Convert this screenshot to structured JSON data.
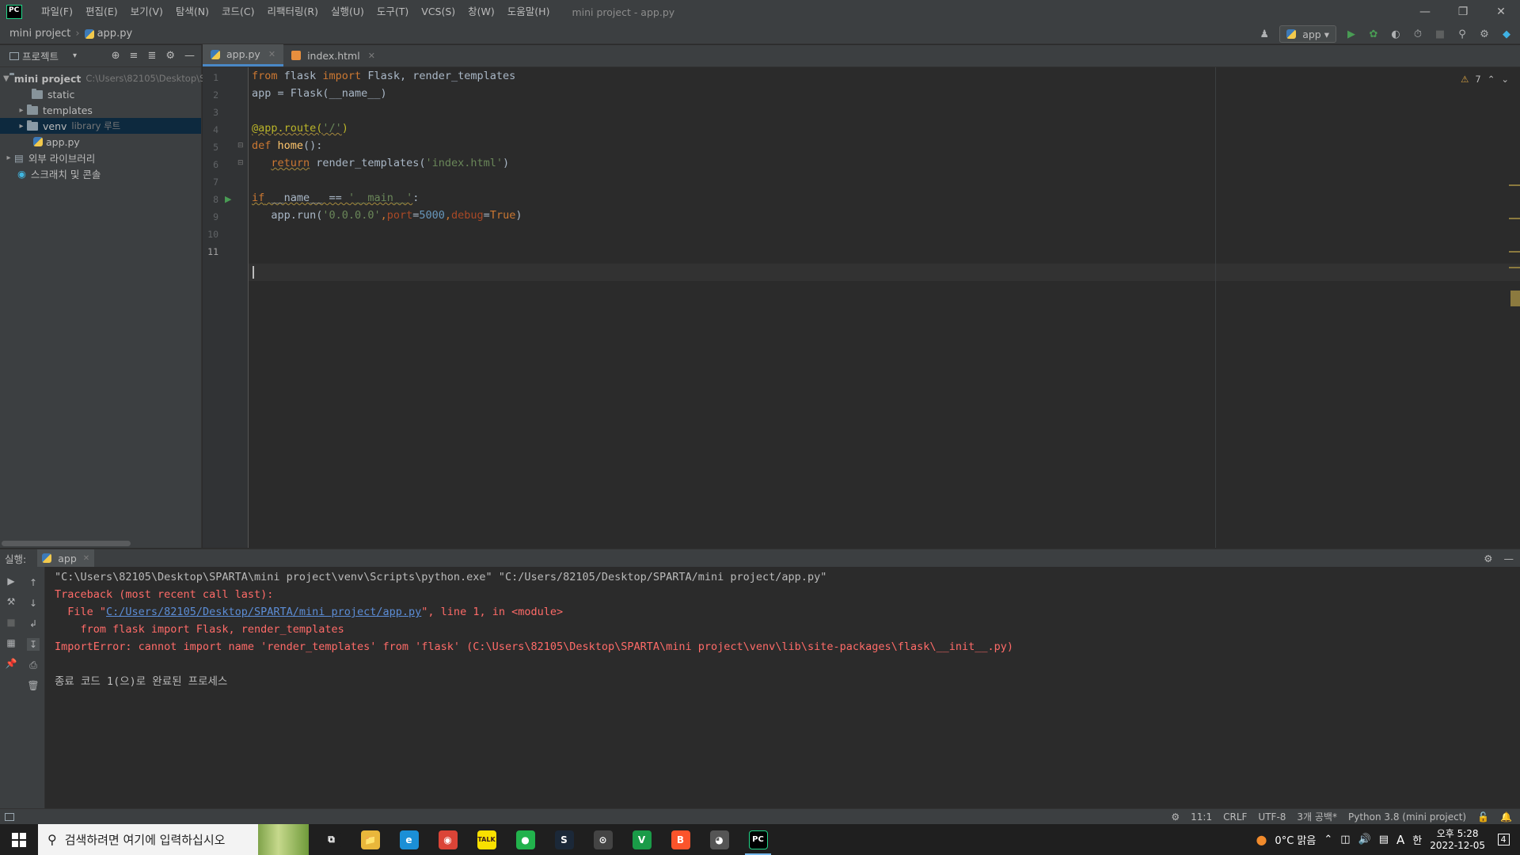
{
  "titlebar": {
    "menu": [
      "파일(F)",
      "편집(E)",
      "보기(V)",
      "탐색(N)",
      "코드(C)",
      "리팩터링(R)",
      "실행(U)",
      "도구(T)",
      "VCS(S)",
      "창(W)",
      "도움말(H)"
    ],
    "window_title": "mini project - app.py",
    "logo": "PC"
  },
  "navbar": {
    "project": "mini project",
    "file": "app.py",
    "run_config": "app"
  },
  "project_panel": {
    "title": "프로젝트",
    "tree": [
      {
        "label": "mini project",
        "hint": "C:\\Users\\82105\\Desktop\\SPARTA\\mini project"
      },
      {
        "label": "static"
      },
      {
        "label": "templates"
      },
      {
        "label": "venv",
        "hint": "library 루트"
      },
      {
        "label": "app.py"
      },
      {
        "label": "외부 라이브러리"
      },
      {
        "label": "스크래치 및 콘솔"
      }
    ]
  },
  "editor": {
    "tabs": [
      {
        "label": "app.py",
        "active": true
      },
      {
        "label": "index.html",
        "active": false
      }
    ],
    "line_numbers": [
      "1",
      "2",
      "3",
      "4",
      "5",
      "6",
      "7",
      "8",
      "9",
      "10",
      "11"
    ],
    "warnings": "7",
    "code": {
      "l1": {
        "kw1": "from",
        "mod": " flask ",
        "kw2": "import",
        "rest": " Flask, render_templates"
      },
      "l2": "app = Flask(__name__)",
      "l4": {
        "deco": "@app.route(",
        "str": "'/'",
        "end": ")"
      },
      "l5": {
        "kw": "def",
        "fn": "home",
        "rest": "():"
      },
      "l6": {
        "kw": "return",
        "rest": " render_templates(",
        "str": "'index.html'",
        "end": ")"
      },
      "l8": {
        "kw": "if",
        "mid": " __name__ == ",
        "str": "'__main__'",
        "end": ":"
      },
      "l9": {
        "pre": "app.run(",
        "str": "'0.0.0.0'",
        "c1": ",",
        "p1": "port",
        "eq1": "=",
        "n1": "5000",
        "c2": ",",
        "p2": "debug",
        "eq2": "=",
        "v2": "True",
        "end": ")"
      }
    }
  },
  "run_window": {
    "label": "실행:",
    "tab": "app",
    "console": {
      "cmd": "\"C:\\Users\\82105\\Desktop\\SPARTA\\mini project\\venv\\Scripts\\python.exe\" \"C:/Users/82105/Desktop/SPARTA/mini project/app.py\"",
      "traceback": "Traceback (most recent call last):",
      "file_prefix": "  File \"",
      "file_link": "C:/Users/82105/Desktop/SPARTA/mini project/app.py",
      "file_suffix": "\", line 1, in <module>",
      "source": "    from flask import Flask, render_templates",
      "error": "ImportError: cannot import name 'render_templates' from 'flask' (C:\\Users\\82105\\Desktop\\SPARTA\\mini project\\venv\\lib\\site-packages\\flask\\__init__.py)",
      "exit": "종료 코드 1(으)로 완료된 프로세스"
    }
  },
  "statusbar": {
    "position": "11:1",
    "line_sep": "CRLF",
    "encoding": "UTF-8",
    "indent": "3개 공백*",
    "interpreter": "Python 3.8 (mini project)"
  },
  "taskbar": {
    "search_placeholder": "검색하려면 여기에 입력하십시오",
    "weather": "0°C 맑음",
    "ime": "A",
    "lang": "한",
    "time": "오후 5:28",
    "date": "2022-12-05",
    "notifications": "4",
    "apps": [
      {
        "name": "task-view",
        "glyph": "⧉",
        "color": "#1f1f1f"
      },
      {
        "name": "file-explorer",
        "glyph": "📁",
        "color": "#e9b73b"
      },
      {
        "name": "edge",
        "glyph": "e",
        "color": "#1b8fd6"
      },
      {
        "name": "chrome",
        "glyph": "◉",
        "color": "#db4437"
      },
      {
        "name": "kakaotalk",
        "glyph": "TALK",
        "color": "#f9e000"
      },
      {
        "name": "line",
        "glyph": "●",
        "color": "#22b24c"
      },
      {
        "name": "steam",
        "glyph": "S",
        "color": "#1b2838"
      },
      {
        "name": "overwatch",
        "glyph": "⊙",
        "color": "#444444"
      },
      {
        "name": "vim",
        "glyph": "V",
        "color": "#1a9b48"
      },
      {
        "name": "brave",
        "glyph": "B",
        "color": "#fb542b"
      },
      {
        "name": "app-panda",
        "glyph": "◕",
        "color": "#555555"
      },
      {
        "name": "pycharm",
        "glyph": "PC",
        "color": "#000000"
      }
    ]
  }
}
